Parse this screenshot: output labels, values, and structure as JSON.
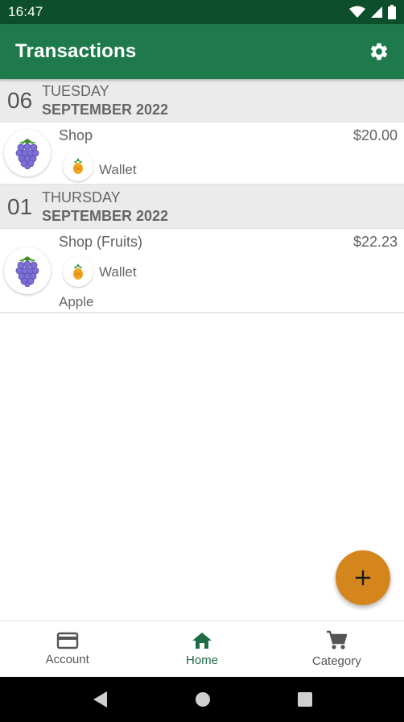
{
  "status_bar": {
    "time": "16:47"
  },
  "app_bar": {
    "title": "Transactions"
  },
  "groups": [
    {
      "day": "06",
      "weekday": "TUESDAY",
      "month": "SEPTEMBER 2022",
      "transactions": [
        {
          "title": "Shop",
          "amount": "$20.00",
          "account": "Wallet",
          "note": "",
          "category_icon": "grapes-icon",
          "account_icon": "pineapple-icon"
        }
      ]
    },
    {
      "day": "01",
      "weekday": "THURSDAY",
      "month": "SEPTEMBER 2022",
      "transactions": [
        {
          "title": "Shop (Fruits)",
          "amount": "$22.23",
          "account": "Wallet",
          "note": "Apple",
          "category_icon": "grapes-icon",
          "account_icon": "pineapple-icon"
        }
      ]
    }
  ],
  "fab": {
    "icon": "plus-icon"
  },
  "bottom_nav": {
    "account_label": "Account",
    "home_label": "Home",
    "category_label": "Category",
    "active": "Home"
  },
  "colors": {
    "status_bar": "#0d4f2c",
    "app_bar": "#1e7a4b",
    "fab": "#d4861d",
    "nav_active": "#1e6b45"
  }
}
